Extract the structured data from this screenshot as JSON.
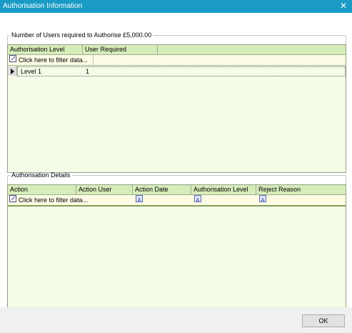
{
  "window": {
    "title": "Authorisation Information",
    "close_glyph": "✕"
  },
  "users_group": {
    "legend": "Number of Users required to Authorise £5,000.00",
    "columns": [
      "Authorisation Level",
      "User Required"
    ],
    "filter_text": "Click here to filter data...",
    "rows": [
      {
        "level": "Level 1",
        "required": "1"
      }
    ]
  },
  "details_group": {
    "legend": "Authorisation Details",
    "columns": [
      "Action",
      "Action User",
      "Action Date",
      "Authorisation Level",
      "Reject Reason"
    ],
    "filter_text": "Click here to filter data...",
    "filter_icon_glyph": "A"
  },
  "buttons": {
    "ok_label": "OK"
  },
  "colors": {
    "titlebar": "#1a9bc6",
    "grid_header": "#d6ecba",
    "grid_body": "#f4fce8",
    "filter_row": "#fefbe4"
  }
}
